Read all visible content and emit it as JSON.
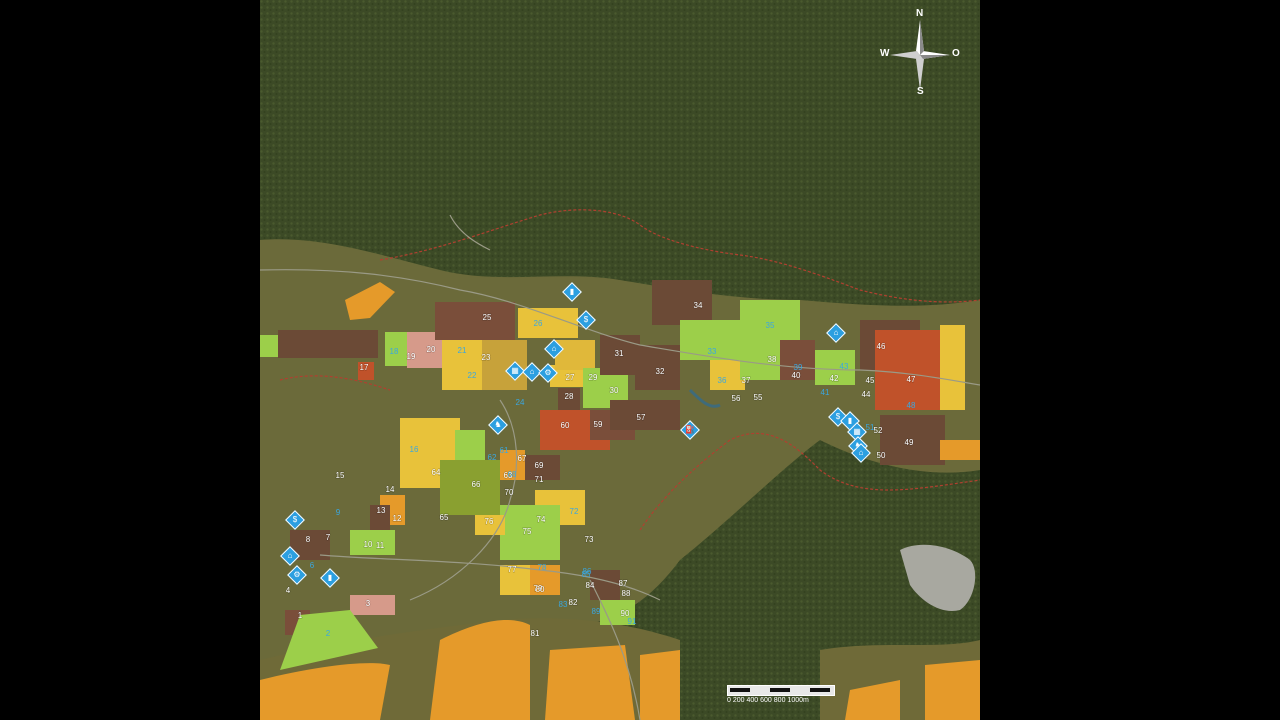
{
  "map": {
    "compass": {
      "north": "N",
      "south": "S",
      "east": "O",
      "west": "W"
    },
    "scale": {
      "ticks": [
        "0",
        "200",
        "400",
        "600",
        "800",
        "1000m"
      ]
    },
    "colors": {
      "forest": "#3c4a26",
      "farmland": "#6b6a3a",
      "field_orange": "#e59a2a",
      "field_yellow": "#e8c23a",
      "field_green": "#9ccf4a",
      "field_brown": "#6b4a36",
      "field_pink": "#d69a8a",
      "poi_blue": "#2c9fe0",
      "border_red": "#b04030"
    },
    "field_labels": [
      "1",
      "2",
      "3",
      "4",
      "5",
      "6",
      "7",
      "8",
      "9",
      "10",
      "11",
      "12",
      "13",
      "14",
      "15",
      "16",
      "17",
      "18",
      "19",
      "20",
      "21",
      "22",
      "23",
      "24",
      "25",
      "26",
      "27",
      "28",
      "29",
      "30",
      "31",
      "32",
      "33",
      "34",
      "35",
      "36",
      "37",
      "38",
      "39",
      "40",
      "41",
      "42",
      "43",
      "44",
      "45",
      "46",
      "47",
      "48",
      "49",
      "50",
      "51",
      "52",
      "53",
      "55",
      "56",
      "57",
      "59",
      "60",
      "61",
      "62",
      "63",
      "64",
      "65",
      "66",
      "67",
      "68",
      "69",
      "70",
      "71",
      "72",
      "73",
      "74",
      "75",
      "76",
      "77",
      "78",
      "79",
      "80",
      "81",
      "82",
      "83",
      "84",
      "85",
      "86",
      "87",
      "88",
      "89",
      "90",
      "91"
    ],
    "poi_icons": [
      "silo-icon",
      "sell-point-icon",
      "shop-icon",
      "factory-icon",
      "farm-icon",
      "animal-icon",
      "production-icon",
      "gas-station-icon",
      "barn-icon",
      "sell-point-icon",
      "silo-icon",
      "factory-icon",
      "animal-icon",
      "shop-icon",
      "sell-point-icon",
      "farm-icon",
      "production-icon",
      "silo-icon"
    ]
  }
}
